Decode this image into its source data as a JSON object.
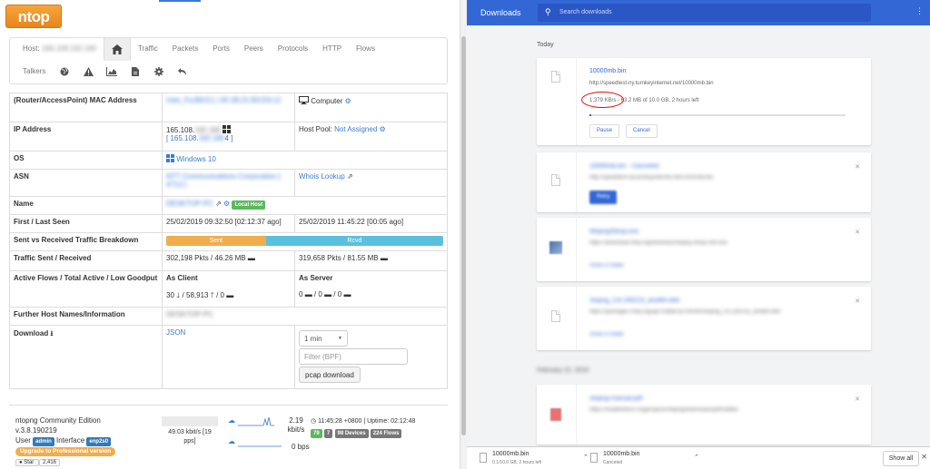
{
  "ntop": {
    "logo": "ntop",
    "nav": {
      "host_label": "Host:",
      "host_value": "166.108.192.180",
      "row1": [
        "Traffic",
        "Packets",
        "Ports",
        "Peers",
        "Protocols",
        "HTTP",
        "Flows"
      ],
      "row2_label": "Talkers"
    },
    "rows": {
      "mac": {
        "label": "(Router/AccessPoint) MAC Address",
        "value1": "Intel_Fa:B8:E1 | 00:1B:21:B3:E9:12",
        "value2": "Computer"
      },
      "ip": {
        "label": "IP Address",
        "value1": "165.108.",
        "value1_hidden": "192.180",
        "value1_link": "[ 165.108.",
        "value1_link_hidden": "192.180",
        "value1_link_end": "4 ]",
        "host_pool_label": "Host Pool:",
        "host_pool_value": "Not Assigned"
      },
      "os": {
        "label": "OS",
        "value": "Windows 10"
      },
      "asn": {
        "label": "ASN",
        "value1": "NTT Communications Corporation [ 4713 ]",
        "value2": "Whois Lookup"
      },
      "name": {
        "label": "Name",
        "value": "DESKTOP-PC",
        "badge": "Local Host"
      },
      "seen": {
        "label": "First / Last Seen",
        "value1": "25/02/2019 09:32:50 [02:12:37 ago]",
        "value2": "25/02/2019 11:45:22 [00:05 ago]"
      },
      "breakdown": {
        "label": "Sent vs Received Traffic Breakdown",
        "sent": "Sent",
        "rcvd": "Rcvd",
        "sent_fraction": 0.36
      },
      "traffic": {
        "label": "Traffic Sent / Received",
        "value1": "302,198 Pkts / 46.26 MB",
        "value2": "319,658 Pkts / 81.55 MB"
      },
      "flows": {
        "label": "Active Flows / Total Active / Low Goodput",
        "client_label": "As Client",
        "server_label": "As Server",
        "client_value_a": "30",
        "client_value_b": "/ 58,913",
        "client_value_c": "/ 0",
        "server_value_a": "0",
        "server_value_b": "/ 0",
        "server_value_c": "/ 0"
      },
      "names": {
        "label": "Further Host Names/Information",
        "value": "DESKTOP-PC"
      },
      "download": {
        "label": "Download",
        "json_link": "JSON",
        "interval": "1 min",
        "filter_placeholder": "Filter (BPF)",
        "pcap_button": "pcap download"
      }
    },
    "footer": {
      "edition": "ntopng Community Edition",
      "version": "v.3.8.190219",
      "user_label": "User",
      "user_value": "admin",
      "interface_label": "Interface",
      "interface_value": "enp2s0",
      "upgrade": "Upgrade to Professional version",
      "star_label": "Star",
      "star_count": "2,416",
      "rate_text": "49.03 kbit/s [19 pps]",
      "up_rate": "2.19 kbit/s",
      "down_rate": "0 bps",
      "time": "11:45:28 +0800 | Uptime: 02:12:48",
      "badges": [
        "79",
        "7",
        "98 Devices",
        "224 Flows"
      ]
    }
  },
  "chrome": {
    "header_title": "Downloads",
    "search_placeholder": "Search downloads",
    "today_label": "Today",
    "active": {
      "name": "10000mb.bin",
      "url": "http://speedtest-ny.turnkeyinternet.net/10000mb.bin",
      "speed": "1,379 KB/s",
      "status": "- 63.2 MB of 10.0 GB, 2 hours left",
      "progress_fraction": 0.006,
      "pause": "Pause",
      "cancel": "Cancel"
    },
    "cancelled": {
      "name": "10000mb.bin - Canceled",
      "url": "http://speedtest-ny.turnkeyinternet.net/10000mb.bin",
      "retry": "Retry"
    },
    "item3": {
      "name": "NtopngSetup.exe",
      "url": "https://download.ntop.org/windows/ntopng-setup-x64.exe",
      "show": "Show in folder"
    },
    "item4": {
      "name": "ntopng_3.8.190219_amd64.deb",
      "url": "https://packages.ntop.org/apt-stable/18.04/x64/ntopng_3.8.190219_amd64.deb",
      "show": "Show in folder"
    },
    "older_date": "February 22, 2019",
    "item5": {
      "name": "ntopng-manual.pdf",
      "url": "https://readthedocs.org/projects/ntopng/downloads/pdf/stable/"
    },
    "shelf": {
      "item1_name": "10000mb.bin",
      "item1_status": "0.1/10.0 GB, 2 hours left",
      "item2_name": "10000mb.bin",
      "item2_status": "Canceled",
      "show_all": "Show all"
    },
    "colors": {
      "header": "#3367d6",
      "link": "#3367d6",
      "highlight": "#dd1111"
    }
  }
}
